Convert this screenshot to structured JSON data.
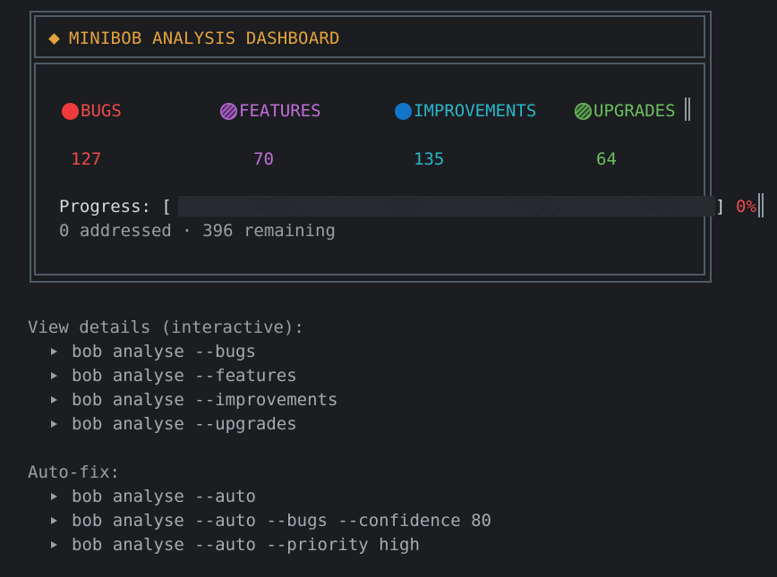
{
  "dashboard": {
    "title": "MINIBOB ANALYSIS DASHBOARD",
    "categories": [
      {
        "key": "bugs",
        "label": "BUGS",
        "count": "127",
        "color": "#ef4a4a",
        "icon": "red-circle-icon"
      },
      {
        "key": "features",
        "label": "FEATURES",
        "count": "70",
        "color": "#c06ed8",
        "icon": "purple-circle-icon"
      },
      {
        "key": "improvements",
        "label": "IMPROVEMENTS",
        "count": "135",
        "color": "#27b6c9",
        "icon": "blue-circle-icon"
      },
      {
        "key": "upgrades",
        "label": "UPGRADES",
        "count": "64",
        "color": "#6cbf5f",
        "icon": "green-circle-icon"
      }
    ],
    "progress": {
      "label": "Progress: [",
      "close": "]",
      "percent": "0%",
      "fraction": 0,
      "addressed": "0 addressed",
      "separator": "·",
      "remaining": "396 remaining"
    }
  },
  "view_details": {
    "title": "View details (interactive):",
    "commands": [
      "bob analyse --bugs",
      "bob analyse --features",
      "bob analyse --improvements",
      "bob analyse --upgrades"
    ]
  },
  "auto_fix": {
    "title": "Auto-fix:",
    "commands": [
      "bob analyse --auto",
      "bob analyse --auto --bugs --confidence 80",
      "bob analyse --auto --priority high"
    ]
  }
}
